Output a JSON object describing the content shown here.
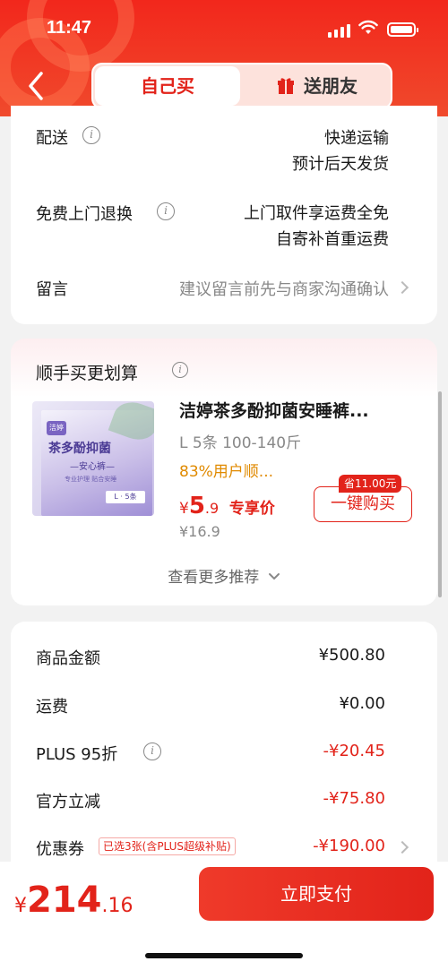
{
  "status_bar": {
    "time": "11:47"
  },
  "tabs": {
    "self": "自己买",
    "gift": "送朋友"
  },
  "delivery": {
    "label": "配送",
    "line1": "快递运输",
    "line2": "预计后天发货"
  },
  "returns": {
    "label": "免费上门退换",
    "line1": "上门取件享运费全免",
    "line2": "自寄补首重运费"
  },
  "message": {
    "label": "留言",
    "placeholder": "建议留言前先与商家沟通确认"
  },
  "recommend": {
    "title": "顺手买更划算",
    "product": {
      "image_brand": "洁婷",
      "image_title": "茶多酚抑菌",
      "image_sub": "—安心裤—",
      "image_note": "专业护理 贴合安睡",
      "image_size": "L · 5条",
      "name": "洁婷茶多酚抑菌安睡裤...",
      "spec": "L 5条 100-140斤",
      "rating": "83%用户顺...",
      "price_symbol": "¥",
      "price_int": "5",
      "price_dec": ".9",
      "price_tag": "专享价",
      "original_price": "¥16.9",
      "save_badge": "省11.00元",
      "buy_button": "一键购买"
    },
    "more": "查看更多推荐"
  },
  "summary": {
    "goods_label": "商品金额",
    "goods_value": "¥500.80",
    "shipping_label": "运费",
    "shipping_value": "¥0.00",
    "plus_label": "PLUS 95折",
    "plus_value": "-¥20.45",
    "official_label": "官方立减",
    "official_value": "-¥75.80",
    "coupon_label": "优惠券",
    "coupon_tag": "已选3张(含PLUS超级补贴)",
    "coupon_value": "-¥190.00"
  },
  "footer": {
    "total_symbol": "¥",
    "total_int": "214",
    "total_dec": ".16",
    "pay_button": "立即支付"
  },
  "colors": {
    "brand_red": "#e2231a",
    "header_red": "#f2271c"
  }
}
